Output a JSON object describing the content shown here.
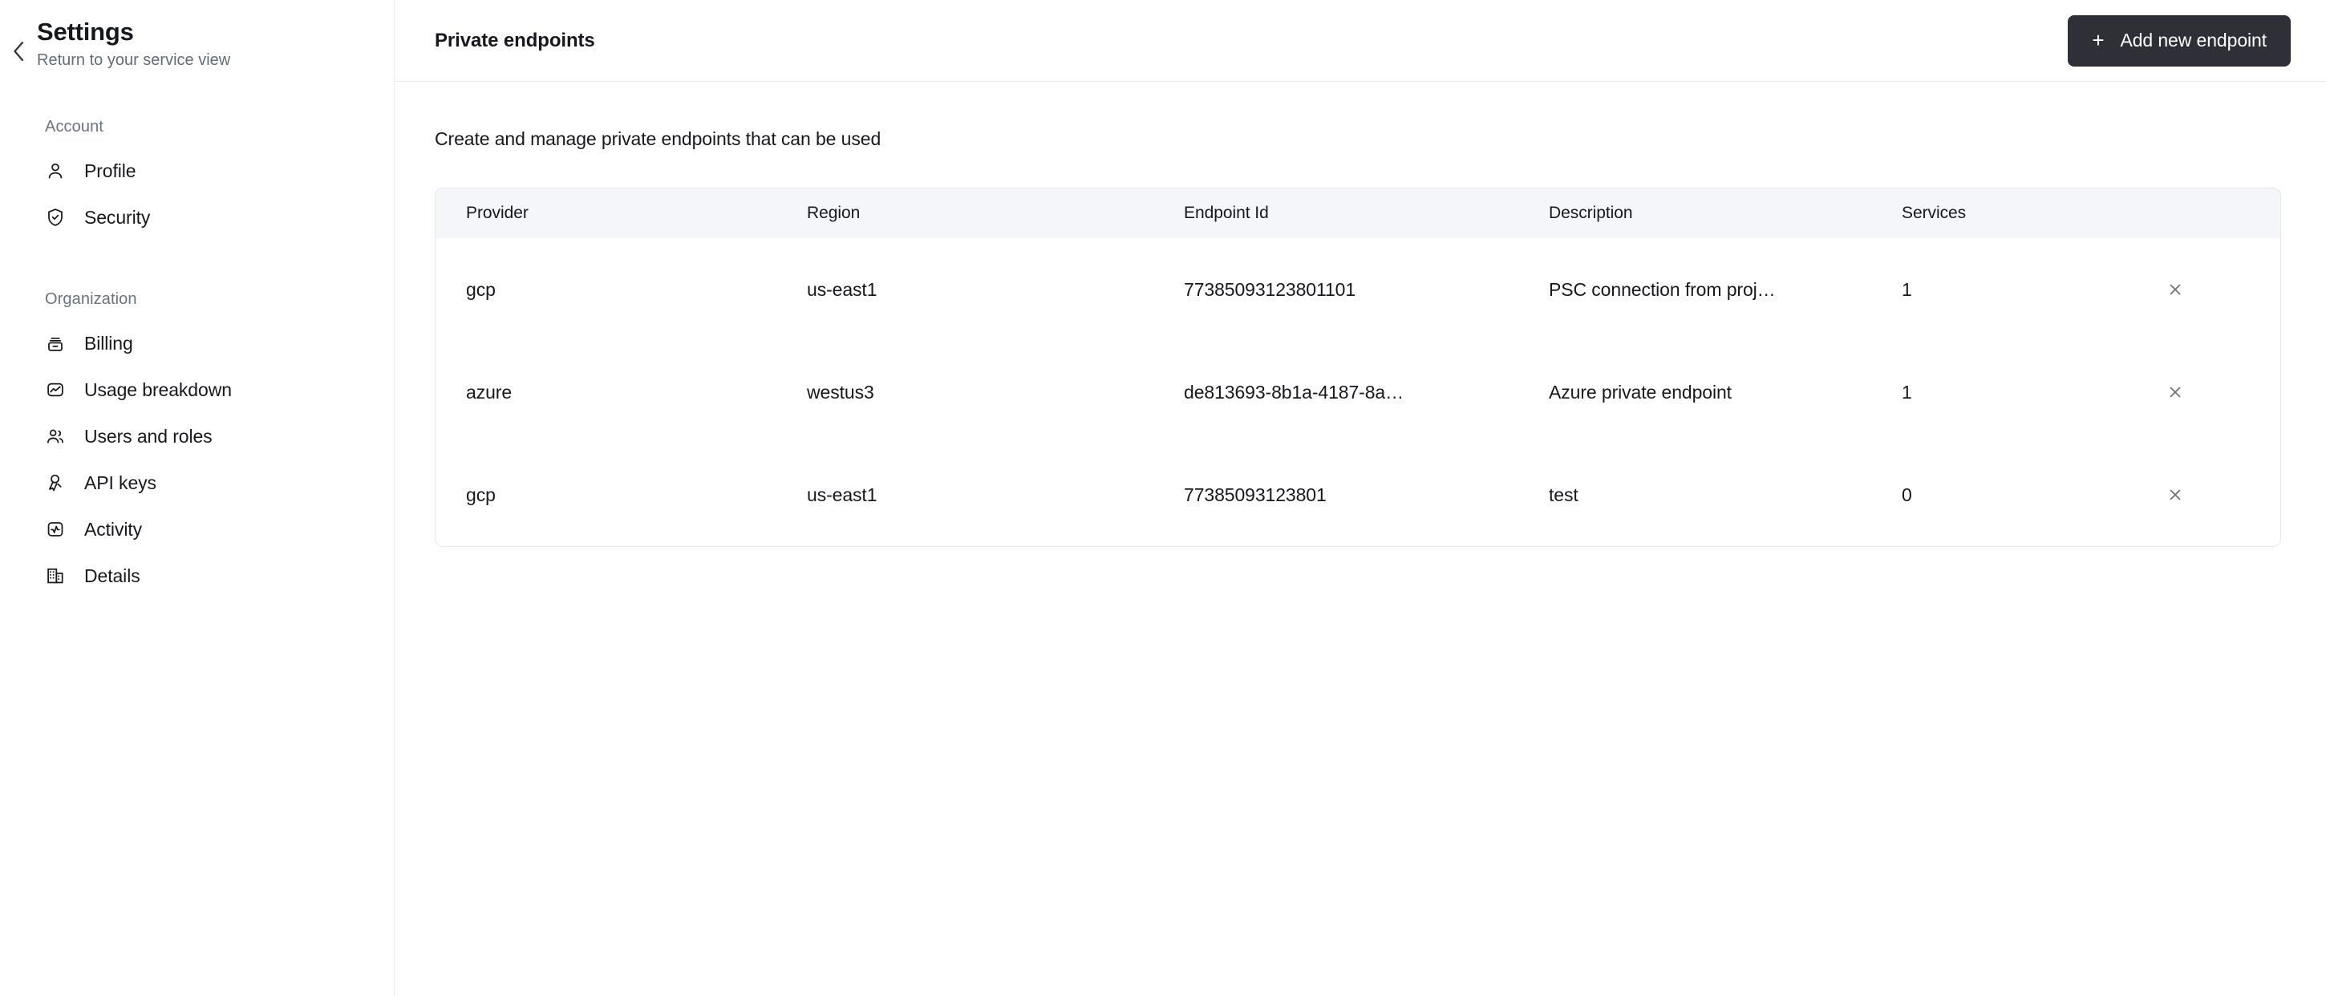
{
  "sidebar": {
    "back_icon": "chevron-left-icon",
    "title": "Settings",
    "subtitle": "Return to your service view",
    "sections": [
      {
        "label": "Account",
        "items": [
          {
            "label": "Profile",
            "icon": "user-icon"
          },
          {
            "label": "Security",
            "icon": "shield-check-icon"
          }
        ]
      },
      {
        "label": "Organization",
        "items": [
          {
            "label": "Billing",
            "icon": "billing-icon"
          },
          {
            "label": "Usage breakdown",
            "icon": "usage-chart-icon"
          },
          {
            "label": "Users and roles",
            "icon": "users-icon"
          },
          {
            "label": "API keys",
            "icon": "key-icon"
          },
          {
            "label": "Activity",
            "icon": "activity-icon"
          },
          {
            "label": "Details",
            "icon": "building-icon"
          }
        ]
      }
    ]
  },
  "header": {
    "title": "Private endpoints",
    "add_button": {
      "label": "Add new endpoint",
      "icon": "plus-icon",
      "background": "#2f3037",
      "text_color": "#ffffff"
    }
  },
  "main": {
    "description": "Create and manage private endpoints that can be used",
    "table": {
      "columns": [
        "Provider",
        "Region",
        "Endpoint Id",
        "Description",
        "Services",
        ""
      ],
      "header_background": "#f5f6f9",
      "border_color": "#e4e7eb",
      "rows": [
        {
          "provider": "gcp",
          "region": "us-east1",
          "endpoint_id": "77385093123801101",
          "description": "PSC connection from proj…",
          "services": "1",
          "remove_icon": "close-icon"
        },
        {
          "provider": "azure",
          "region": "westus3",
          "endpoint_id": "de813693-8b1a-4187-8a…",
          "description": "Azure private endpoint",
          "services": "1",
          "remove_icon": "close-icon"
        },
        {
          "provider": "gcp",
          "region": "us-east1",
          "endpoint_id": "77385093123801",
          "description": "test",
          "services": "0",
          "remove_icon": "close-icon"
        }
      ]
    }
  }
}
